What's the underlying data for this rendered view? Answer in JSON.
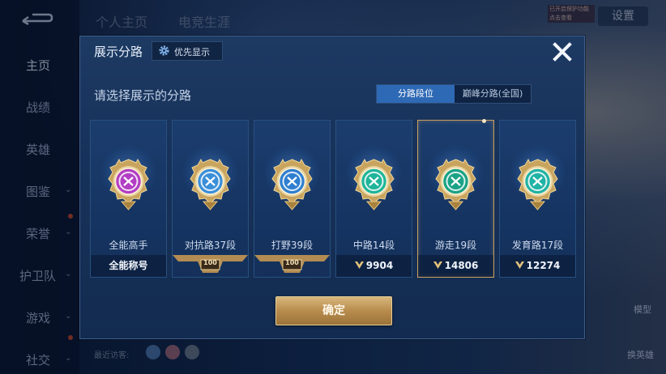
{
  "background": {
    "tabs": [
      "个人主页",
      "电竞生涯"
    ],
    "settings_label": "设置",
    "status_tag": "已开启保护功能 点击查看",
    "nav": [
      "主页",
      "战绩",
      "英雄",
      "图鉴",
      "荣誉",
      "护卫队",
      "游戏",
      "社交"
    ],
    "visitors_label": "最近访客:",
    "side_labels": [
      "模型",
      "换英雄"
    ]
  },
  "dialog": {
    "title": "展示分路",
    "priority_button": "优先显示",
    "subtitle": "请选择展示的分路",
    "segment": [
      {
        "label": "分路段位",
        "active": true
      },
      {
        "label": "巅峰分路(全国)",
        "active": false
      }
    ],
    "cards": [
      {
        "name": "全能高手",
        "bottom": "全能称号",
        "bottom_type": "text",
        "emblem": "all-round-emblem-icon",
        "color": "#b23ec4",
        "selected": false
      },
      {
        "name": "对抗路37段",
        "bottom": "100",
        "bottom_type": "badge",
        "emblem": "clash-lane-emblem-icon",
        "color": "#3a8fd8",
        "selected": false
      },
      {
        "name": "打野39段",
        "bottom": "100",
        "bottom_type": "badge",
        "emblem": "jungle-emblem-icon",
        "color": "#2f7fd0",
        "selected": false
      },
      {
        "name": "中路14段",
        "bottom": "9904",
        "bottom_type": "score",
        "emblem": "mid-lane-emblem-icon",
        "color": "#1fb59a",
        "selected": false
      },
      {
        "name": "游走19段",
        "bottom": "14806",
        "bottom_type": "score",
        "emblem": "roam-emblem-icon",
        "color": "#1aa286",
        "selected": true
      },
      {
        "name": "发育路17段",
        "bottom": "12274",
        "bottom_type": "score",
        "emblem": "farm-lane-emblem-icon",
        "color": "#21b3a6",
        "selected": false
      }
    ],
    "confirm_label": "确定"
  }
}
